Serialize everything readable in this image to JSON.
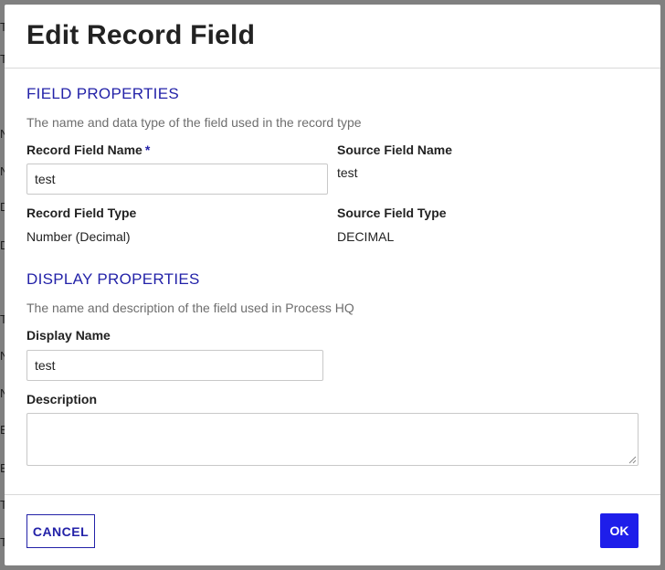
{
  "background": {
    "row_letters": [
      "T",
      "T",
      "N",
      "N",
      "D",
      "D",
      "T",
      "N",
      "N",
      "E",
      "E",
      "T",
      "T"
    ]
  },
  "dialog": {
    "title": "Edit Record Field",
    "field_properties": {
      "heading": "FIELD PROPERTIES",
      "description": "The name and data type of the field used in the record type",
      "record_field_name_label": "Record Field Name",
      "required_marker": "*",
      "record_field_name_value": "test",
      "source_field_name_label": "Source Field Name",
      "source_field_name_value": "test",
      "record_field_type_label": "Record Field Type",
      "record_field_type_value": "Number (Decimal)",
      "source_field_type_label": "Source Field Type",
      "source_field_type_value": "DECIMAL"
    },
    "display_properties": {
      "heading": "DISPLAY PROPERTIES",
      "description": "The name and description of the field used in Process HQ",
      "display_name_label": "Display Name",
      "display_name_value": "test",
      "description_label": "Description",
      "description_value": ""
    },
    "footer": {
      "cancel_label": "CANCEL",
      "ok_label": "OK"
    }
  },
  "colors": {
    "accent": "#2322a8",
    "primary_button": "#1e1eea",
    "overlay": "#808080"
  }
}
